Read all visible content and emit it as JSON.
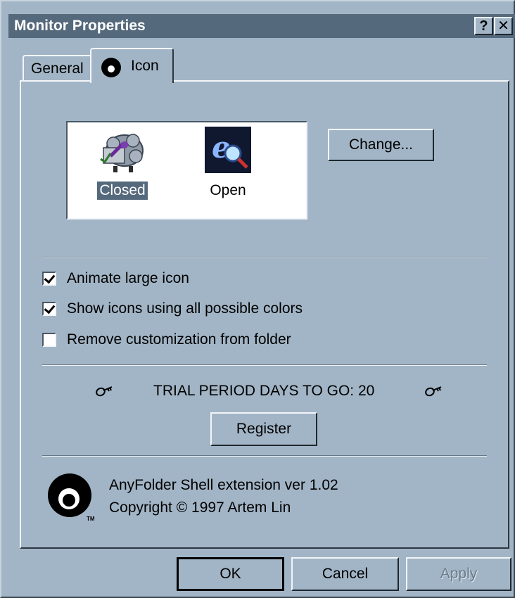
{
  "window": {
    "title": "Monitor Properties",
    "help_glyph": "?",
    "close_glyph": "✕"
  },
  "tabs": [
    {
      "label": "General",
      "selected": false
    },
    {
      "label": "Icon",
      "selected": true,
      "icon": "anyfolder-logo-icon"
    }
  ],
  "icons": {
    "closed": {
      "label": "Closed",
      "icon": "sheep-folder-icon",
      "selected": true
    },
    "open": {
      "label": "Open",
      "icon": "internet-explorer-magnifier-icon",
      "selected": false
    }
  },
  "change_button": "Change...",
  "checkboxes": [
    {
      "label": "Animate large icon",
      "checked": true
    },
    {
      "label": "Show icons using all possible colors",
      "checked": true
    },
    {
      "label": "Remove customization from folder",
      "checked": false
    }
  ],
  "trial": {
    "text": "TRIAL PERIOD DAYS TO GO: 20",
    "icon": "key-icon"
  },
  "register_button": "Register",
  "about": {
    "line1": "AnyFolder Shell extension ver 1.02",
    "line2": "Copyright © 1997 Artem Lin",
    "logo": "anyfolder-logo-icon",
    "tm": "TM"
  },
  "buttons": {
    "ok": "OK",
    "cancel": "Cancel",
    "apply": "Apply",
    "apply_enabled": false
  },
  "colors": {
    "face": "#a2b5c6",
    "title_bar": "#55697c",
    "selection": "#55697c"
  }
}
